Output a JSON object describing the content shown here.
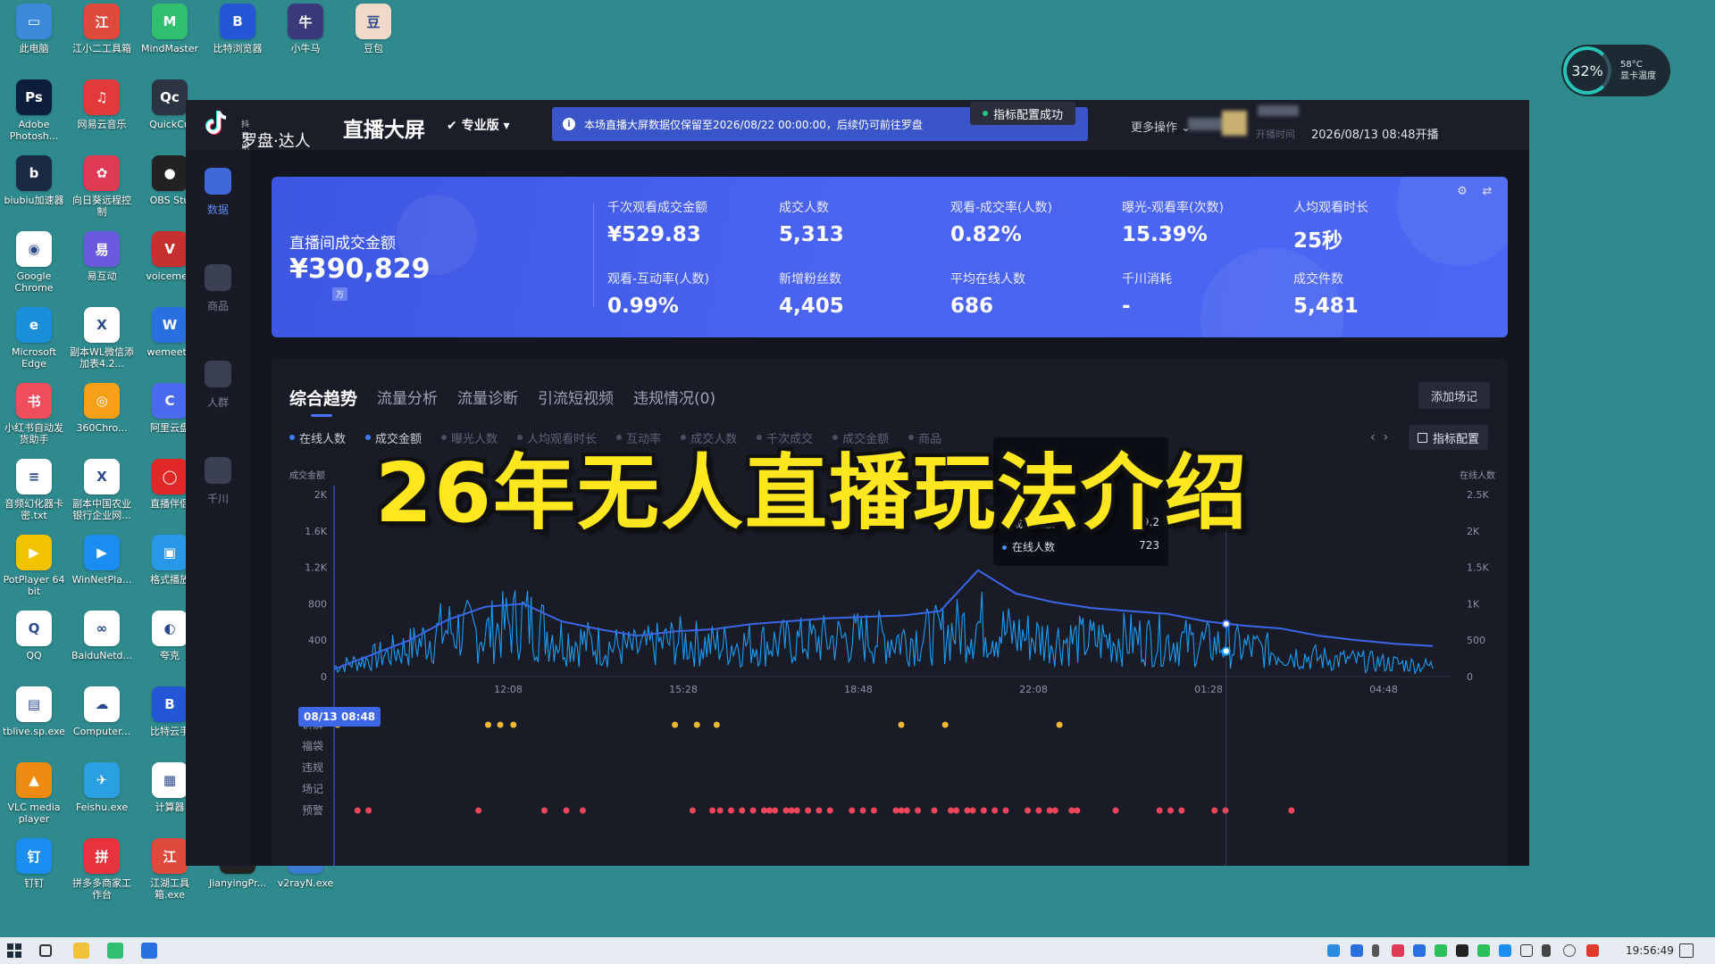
{
  "desktop": {
    "icons": [
      {
        "label": "此电脑",
        "color": "#3b8ad9",
        "glyph": "▭"
      },
      {
        "label": "江小二工具箱",
        "color": "#e04a3c",
        "glyph": "江"
      },
      {
        "label": "MindMaster",
        "color": "#2fbf71",
        "glyph": "M"
      },
      {
        "label": "比特浏览器",
        "color": "#2457d6",
        "glyph": "B"
      },
      {
        "label": "小牛马",
        "color": "#3a3a7a",
        "glyph": "牛"
      },
      {
        "label": "豆包",
        "color": "#f0d9c8",
        "glyph": "豆"
      },
      {
        "label": "Adobe Photosh...",
        "color": "#0c1e3c",
        "glyph": "Ps"
      },
      {
        "label": "网易云音乐",
        "color": "#e23a3a",
        "glyph": "♫"
      },
      {
        "label": "QuickCu",
        "color": "#2a3442",
        "glyph": "Qc"
      },
      {
        "label": "biubiu加速器",
        "color": "#1a2a44",
        "glyph": "b"
      },
      {
        "label": "向日葵远程控制",
        "color": "#e03a56",
        "glyph": "✿"
      },
      {
        "label": "OBS Stu",
        "color": "#222222",
        "glyph": "●"
      },
      {
        "label": "Google Chrome",
        "color": "#ffffff",
        "glyph": "◉"
      },
      {
        "label": "易互动",
        "color": "#6a5adf",
        "glyph": "易"
      },
      {
        "label": "voicemee",
        "color": "#c83030",
        "glyph": "V"
      },
      {
        "label": "Microsoft Edge",
        "color": "#1a8ed8",
        "glyph": "e"
      },
      {
        "label": "副本WL微信添加表4.2...",
        "color": "#ffffff",
        "glyph": "X"
      },
      {
        "label": "wemeeta",
        "color": "#2a6fe0",
        "glyph": "W"
      },
      {
        "label": "小红书自动发货助手",
        "color": "#f04d5d",
        "glyph": "书"
      },
      {
        "label": "360Chro...",
        "color": "#f6a01a",
        "glyph": "◎"
      },
      {
        "label": "阿里云盘",
        "color": "#4a6bf0",
        "glyph": "C"
      },
      {
        "label": "音频幻化器卡密.txt",
        "color": "#ffffff",
        "glyph": "≡"
      },
      {
        "label": "副本中国农业银行企业网...",
        "color": "#ffffff",
        "glyph": "X"
      },
      {
        "label": "直播伴侣",
        "color": "#e02828",
        "glyph": "◯"
      },
      {
        "label": "PotPlayer 64 bit",
        "color": "#f2c400",
        "glyph": "▶"
      },
      {
        "label": "WinNetPla...",
        "color": "#1a8ef0",
        "glyph": "▶"
      },
      {
        "label": "格式播放",
        "color": "#2a98e8",
        "glyph": "▣"
      },
      {
        "label": "QQ",
        "color": "#ffffff",
        "glyph": "Q"
      },
      {
        "label": "BaiduNetd...",
        "color": "#ffffff",
        "glyph": "∞"
      },
      {
        "label": "夸克",
        "color": "#ffffff",
        "glyph": "◐"
      },
      {
        "label": "tblive.sp.exe",
        "color": "#ffffff",
        "glyph": "▤"
      },
      {
        "label": "Computer...",
        "color": "#ffffff",
        "glyph": "☁"
      },
      {
        "label": "比特云手",
        "color": "#2457d6",
        "glyph": "B"
      },
      {
        "label": "VLC media player",
        "color": "#f08a10",
        "glyph": "▲"
      },
      {
        "label": "Feishu.exe",
        "color": "#2aa0e0",
        "glyph": "✈"
      },
      {
        "label": "计算器",
        "color": "#ffffff",
        "glyph": "▦"
      },
      {
        "label": "钉钉",
        "color": "#1a8ef0",
        "glyph": "钉"
      },
      {
        "label": "拼多多商家工作台",
        "color": "#e8323c",
        "glyph": "拼"
      },
      {
        "label": "江湖工具箱.exe",
        "color": "#e04a3c",
        "glyph": "江"
      },
      {
        "label": "JianyingPr...",
        "color": "#222222",
        "glyph": "剪"
      },
      {
        "label": "v2rayN.exe",
        "color": "#3a7ad0",
        "glyph": "V"
      }
    ]
  },
  "temp_widget": {
    "percent": "32%",
    "temp": "58°C",
    "label": "显卡温度"
  },
  "app": {
    "logo_small": "抖音电商",
    "logo_text": "罗盘·达人",
    "title": "直播大屏",
    "edition": "专业版",
    "notice": "本场直播大屏数据仅保留至2026/08/22 00:00:00，后续仍可前往罗盘",
    "toast": "指标配置成功",
    "more_ops": "更多操作",
    "start_label": "开播时间",
    "start_time": "2026/08/13 08:48开播"
  },
  "sidebar": {
    "items": [
      {
        "label": "数据"
      },
      {
        "label": "商品"
      },
      {
        "label": "人群"
      },
      {
        "label": "千川"
      }
    ]
  },
  "kpi": {
    "main_label": "直播间成交金额",
    "main_value": "¥390,829",
    "unit_badge": "万",
    "cells": [
      {
        "label": "千次观看成交金额",
        "value": "¥529.83"
      },
      {
        "label": "成交人数",
        "value": "5,313"
      },
      {
        "label": "观看-成交率(人数)",
        "value": "0.82%"
      },
      {
        "label": "曝光-观看率(次数)",
        "value": "15.39%"
      },
      {
        "label": "人均观看时长",
        "value": "25秒"
      },
      {
        "label": "观看-互动率(人数)",
        "value": "0.99%"
      },
      {
        "label": "新增粉丝数",
        "value": "4,405"
      },
      {
        "label": "平均在线人数",
        "value": "686"
      },
      {
        "label": "千川消耗",
        "value": "-"
      },
      {
        "label": "成交件数",
        "value": "5,481"
      }
    ]
  },
  "trend": {
    "tabs": [
      "综合趋势",
      "流量分析",
      "流量诊断",
      "引流短视频",
      "违规情况(0)"
    ],
    "add_note": "添加场记",
    "metric_chips": [
      {
        "label": "在线人数",
        "active": true
      },
      {
        "label": "成交金额",
        "active": true
      },
      {
        "label": "曝光人数",
        "active": false
      },
      {
        "label": "人均观看时长",
        "active": false
      },
      {
        "label": "互动率",
        "active": false
      },
      {
        "label": "成交人数",
        "active": false
      },
      {
        "label": "千次成交",
        "active": false
      },
      {
        "label": "成交金额",
        "active": false
      },
      {
        "label": "商品",
        "active": false
      }
    ],
    "metric_config": "指标配置",
    "time_badge": "08/13 08:48",
    "tooltip": {
      "rows": [
        {
          "label": "成交金额",
          "value": "279.2"
        },
        {
          "label": "在线人数",
          "value": "723"
        }
      ]
    },
    "event_rows": [
      "讲解",
      "福袋",
      "违规",
      "场记",
      "预警"
    ]
  },
  "chart_data": {
    "type": "line",
    "xlabel": "",
    "ylabel": "成交金额",
    "y2label": "在线人数",
    "x_ticks": [
      "12:08",
      "15:28",
      "18:48",
      "22:08",
      "01:28",
      "04:48"
    ],
    "y_ticks_left": [
      "0",
      "400",
      "800",
      "1.2K",
      "1.6K",
      "2K"
    ],
    "y_ticks_right": [
      "0",
      "500",
      "1K",
      "1.5K",
      "2K",
      "2.5K"
    ],
    "ylim": [
      0,
      2000
    ],
    "y2lim": [
      0,
      2500
    ],
    "series": [
      {
        "name": "成交金额",
        "color": "#1aa3ff",
        "axis": "left",
        "envelope": [
          180,
          350,
          560,
          900,
          820,
          1100,
          720,
          600,
          520,
          680,
          600,
          620,
          650,
          700,
          750,
          720,
          800,
          1000,
          780,
          700,
          680,
          720,
          680,
          620,
          560,
          450,
          350,
          300,
          250,
          200
        ]
      },
      {
        "name": "在线人数",
        "color": "#3a66e8",
        "axis": "right",
        "values": [
          100,
          300,
          500,
          780,
          960,
          1000,
          760,
          650,
          560,
          620,
          650,
          720,
          760,
          800,
          820,
          840,
          900,
          1460,
          1140,
          1020,
          940,
          900,
          860,
          760,
          700,
          660,
          560,
          500,
          450,
          420
        ]
      }
    ],
    "events": {
      "讲解": [
        0.0,
        0.137,
        0.148,
        0.16,
        0.307,
        0.327,
        0.345,
        0.513,
        0.553,
        0.657
      ],
      "预警": [
        0.01,
        0.02,
        0.12,
        0.18,
        0.2,
        0.215,
        0.315,
        0.333,
        0.34,
        0.35,
        0.36,
        0.37,
        0.38,
        0.385,
        0.39,
        0.4,
        0.405,
        0.41,
        0.42,
        0.43,
        0.44,
        0.46,
        0.47,
        0.48,
        0.5,
        0.505,
        0.51,
        0.52,
        0.535,
        0.55,
        0.555,
        0.565,
        0.57,
        0.58,
        0.59,
        0.6,
        0.62,
        0.63,
        0.64,
        0.645,
        0.66,
        0.665,
        0.7,
        0.74,
        0.75,
        0.76,
        0.79,
        0.8,
        0.86
      ]
    }
  },
  "overlay": {
    "title": "26年无人直播玩法介绍"
  },
  "taskbar": {
    "clock": "19:56:49"
  }
}
